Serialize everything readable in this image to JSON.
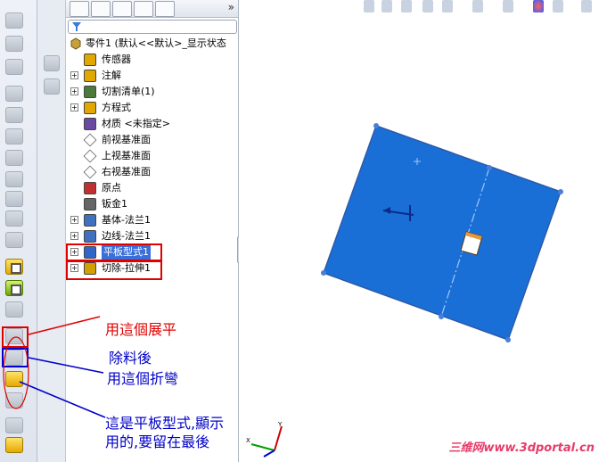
{
  "tree": {
    "root_label": "零件1  (默认<<默认>_显示状态",
    "items": [
      {
        "label": "传感器",
        "icon": "sensor-icon",
        "expandable": false
      },
      {
        "label": "注解",
        "icon": "annotation-icon",
        "expandable": true
      },
      {
        "label": "切割清单(1)",
        "icon": "cutlist-icon",
        "expandable": true
      },
      {
        "label": "方程式",
        "icon": "equation-icon",
        "expandable": true
      },
      {
        "label": "材质 <未指定>",
        "icon": "material-icon",
        "expandable": false
      },
      {
        "label": "前视基准面",
        "icon": "plane-icon",
        "expandable": false
      },
      {
        "label": "上视基准面",
        "icon": "plane-icon",
        "expandable": false
      },
      {
        "label": "右视基准面",
        "icon": "plane-icon",
        "expandable": false
      },
      {
        "label": "原点",
        "icon": "origin-icon",
        "expandable": false
      },
      {
        "label": "钣金1",
        "icon": "sheetmetal-icon",
        "expandable": false
      },
      {
        "label": "基体-法兰1",
        "icon": "base-flange-icon",
        "expandable": true
      },
      {
        "label": "边线-法兰1",
        "icon": "edge-flange-icon",
        "expandable": true
      },
      {
        "label": "平板型式1",
        "icon": "flat-pattern-icon",
        "expandable": true,
        "selected": true
      },
      {
        "label": "切除-拉伸1",
        "icon": "cut-extrude-icon",
        "expandable": true
      }
    ]
  },
  "annotations": {
    "flatten": "用這個展平",
    "after_cut_line1": "除料後",
    "after_cut_line2": "用這個折彎",
    "note_line1": "這是平板型式,顯示",
    "note_line2": "用的,要留在最後"
  },
  "watermark": "三维网www.3dportal.cn",
  "colors": {
    "part_blue": "#1a6fd6",
    "part_edge": "#2c5aa8",
    "annotation_red": "#e00000",
    "annotation_blue": "#0000c8"
  }
}
